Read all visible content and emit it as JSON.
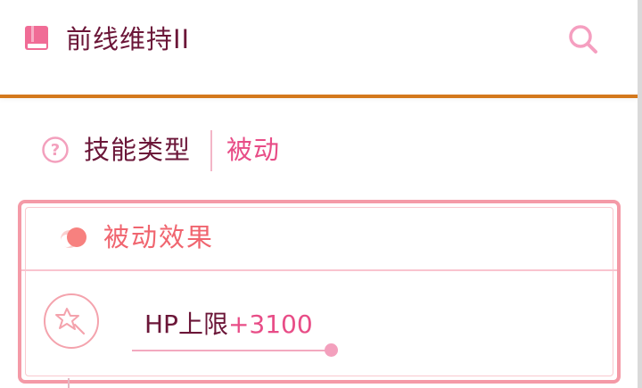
{
  "header": {
    "icon": "book-icon",
    "title": "前线维持II",
    "search_icon": "search-icon"
  },
  "skill_type": {
    "icon": "help-circle-icon",
    "label": "技能类型",
    "value": "被动"
  },
  "effect_card": {
    "icon": "passive-effect-icon",
    "title": "被动效果",
    "stat_icon": "star-wand-icon",
    "stat_name": "HP上限",
    "stat_value": "+3100"
  },
  "colors": {
    "accent_orange": "#d4791d",
    "title_text": "#6b1638",
    "pink": "#e84d87",
    "coral": "#f0656f",
    "card_border": "#f49aa7"
  }
}
